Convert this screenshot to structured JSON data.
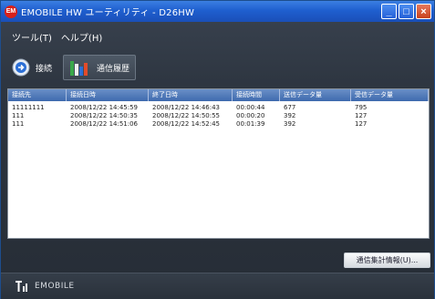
{
  "window": {
    "logo_text": "EM",
    "title": "EMOBILE HW ユーティリティ - D26HW",
    "minimize": "_",
    "maximize": "□",
    "close": "×"
  },
  "menu": {
    "items": [
      {
        "label": "ツール(T)"
      },
      {
        "label": "ヘルプ(H)"
      }
    ]
  },
  "toolbar": {
    "connect_label": "接続",
    "history_label": "通信履歴",
    "connect_icon": "connect-icon",
    "history_icon": "bar-chart-icon"
  },
  "table": {
    "headers": [
      "接続先",
      "接続日時",
      "終了日時",
      "接続時間",
      "送信データ量",
      "受信データ量"
    ],
    "rows": [
      [
        "11111111",
        "2008/12/22 14:45:59",
        "2008/12/22 14:46:43",
        "00:00:44",
        "677",
        "795"
      ],
      [
        "111",
        "2008/12/22 14:50:35",
        "2008/12/22 14:50:55",
        "00:00:20",
        "392",
        "127"
      ],
      [
        "111",
        "2008/12/22 14:51:06",
        "2008/12/22 14:52:45",
        "00:01:39",
        "392",
        "127"
      ]
    ]
  },
  "detail_button": "通信集計情報(U)...",
  "status": {
    "brand": "EMOBILE",
    "signal_icon": "signal-strength-icon"
  },
  "colors": {
    "titlebar": "#1f5fcf",
    "background": "#2d3540",
    "header": "#3e6aae"
  }
}
